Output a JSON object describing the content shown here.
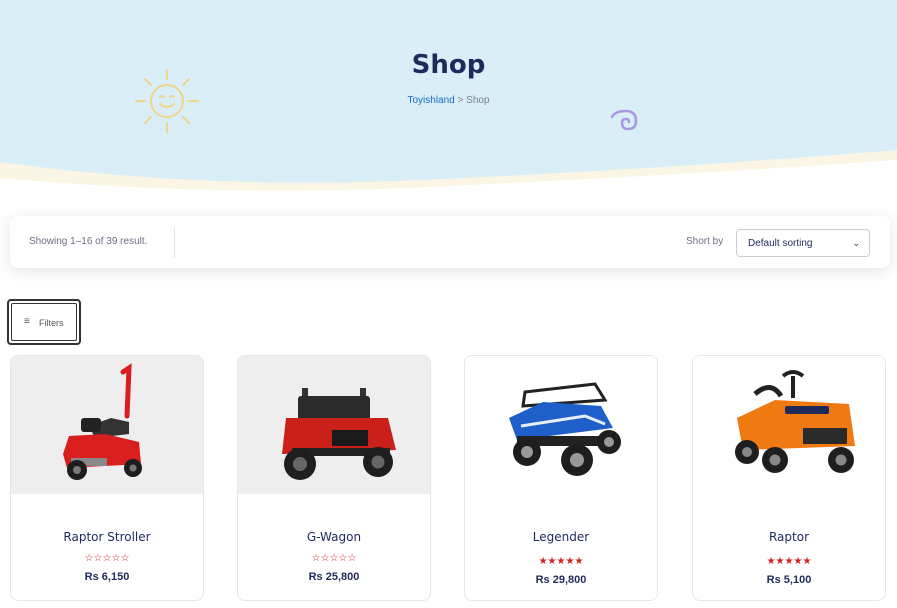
{
  "hero": {
    "title": "Shop",
    "breadcrumb_link": "Toyishland",
    "breadcrumb_sep": " > ",
    "breadcrumb_current": "Shop"
  },
  "toolbar": {
    "result_count": "Showing 1–16 of 39 result.",
    "sort_label": "Short by",
    "sort_value": "Default sorting"
  },
  "filters": {
    "label": "Filters"
  },
  "products": [
    {
      "name": "Raptor Stroller",
      "stars": "☆☆☆☆☆",
      "price": "Rs 6,150",
      "color": "#d91e1e"
    },
    {
      "name": "G-Wagon",
      "stars": "☆☆☆☆☆",
      "price": "Rs 25,800",
      "color": "#c9201a"
    },
    {
      "name": "Legender",
      "stars": "★★★★★",
      "price": "Rs 29,800",
      "color": "#1f5fc9"
    },
    {
      "name": "Raptor",
      "stars": "★★★★★",
      "price": "Rs 5,100",
      "color": "#f07a12"
    }
  ]
}
